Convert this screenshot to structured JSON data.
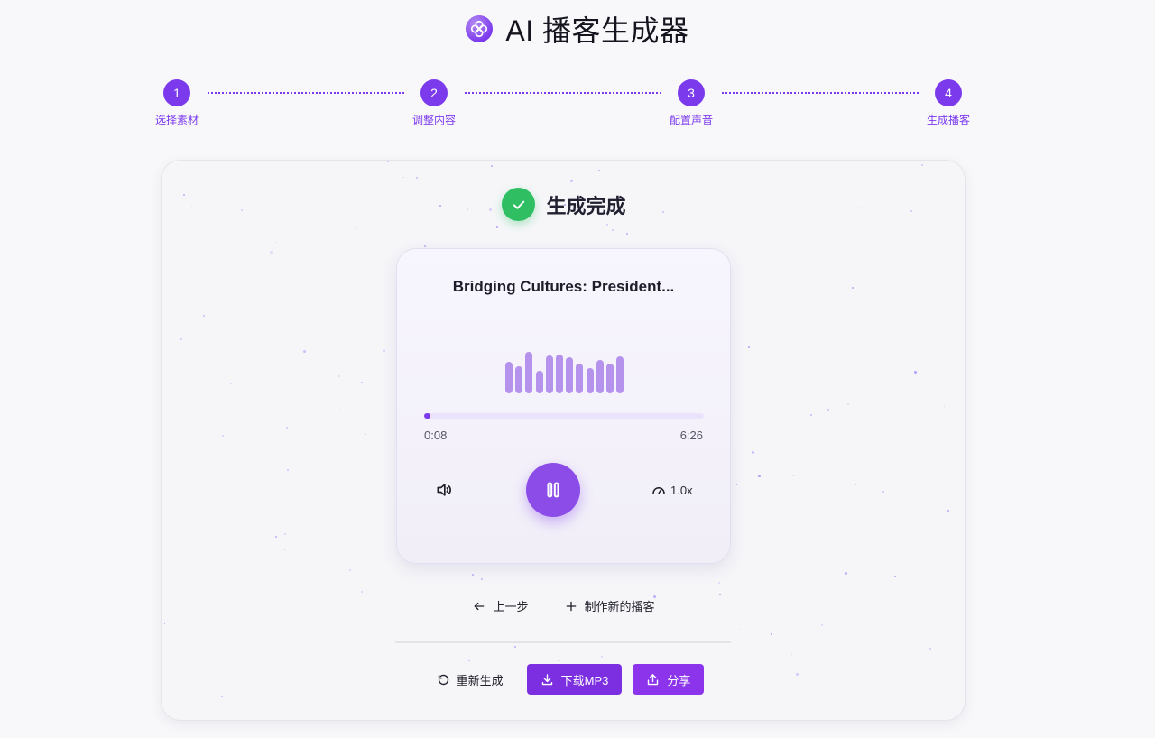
{
  "header": {
    "app_title": "AI 播客生成器",
    "logo_icon": "clover-logo-icon"
  },
  "stepper": {
    "steps": [
      {
        "number": "1",
        "label": "选择素材"
      },
      {
        "number": "2",
        "label": "调整内容"
      },
      {
        "number": "3",
        "label": "配置声音"
      },
      {
        "number": "4",
        "label": "生成播客"
      }
    ],
    "accent_color": "#7c3aed"
  },
  "status": {
    "title": "生成完成",
    "icon": "check-icon",
    "color": "#2fbf62"
  },
  "player": {
    "title": "Bridging Cultures: President...",
    "current_time": "0:08",
    "total_time": "6:26",
    "progress_fraction": 0.021,
    "speed": "1.0x",
    "state": "playing",
    "waveform_levels": [
      0.77,
      0.66,
      1.0,
      0.54,
      0.91,
      0.94,
      0.87,
      0.71,
      0.6,
      0.8,
      0.71,
      0.89
    ]
  },
  "secondary_actions": {
    "back_label": "上一步",
    "new_podcast_label": "制作新的播客"
  },
  "bottom_actions": {
    "regenerate_label": "重新生成",
    "download_label": "下载MP3",
    "share_label": "分享"
  }
}
